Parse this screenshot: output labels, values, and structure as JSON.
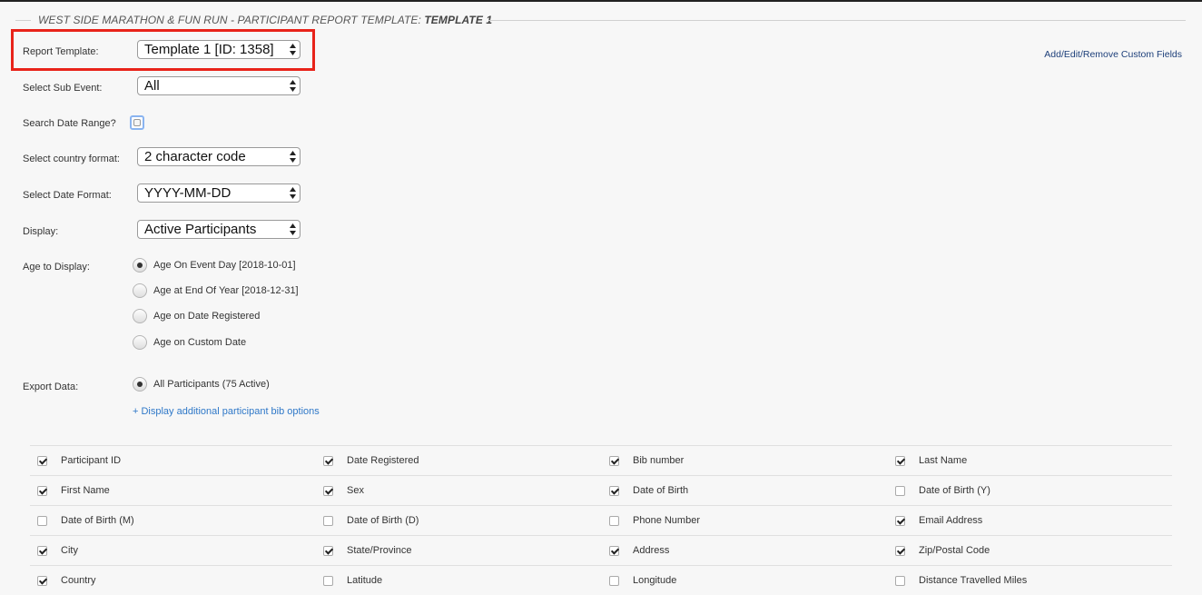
{
  "header": {
    "title_prefix": "WEST SIDE MARATHON & FUN RUN - PARTICIPANT REPORT TEMPLATE: ",
    "title_template": "TEMPLATE 1"
  },
  "links": {
    "custom_fields": "Add/Edit/Remove Custom Fields",
    "bib_options": "+ Display additional participant bib options"
  },
  "form": {
    "report_template": {
      "label": "Report Template:",
      "value": "Template 1 [ID: 1358]"
    },
    "sub_event": {
      "label": "Select Sub Event:",
      "value": "All"
    },
    "date_range": {
      "label": "Search Date Range?",
      "checked": false
    },
    "country_format": {
      "label": "Select country format:",
      "value": "2 character code"
    },
    "date_format": {
      "label": "Select Date Format:",
      "value": "YYYY-MM-DD"
    },
    "display": {
      "label": "Display:",
      "value": "Active Participants"
    },
    "age_display": {
      "label": "Age to Display:",
      "options": [
        {
          "label": "Age On Event Day [2018-10-01]",
          "checked": true
        },
        {
          "label": "Age at End Of Year [2018-12-31]",
          "checked": false
        },
        {
          "label": "Age on Date Registered",
          "checked": false
        },
        {
          "label": "Age on Custom Date",
          "checked": false
        }
      ]
    },
    "export_data": {
      "label": "Export Data:",
      "options": [
        {
          "label": "All Participants (75 Active)",
          "checked": true
        }
      ]
    }
  },
  "fields": [
    [
      {
        "label": "Participant ID",
        "checked": true
      },
      {
        "label": "Date Registered",
        "checked": true
      },
      {
        "label": "Bib number",
        "checked": true
      },
      {
        "label": "Last Name",
        "checked": true
      }
    ],
    [
      {
        "label": "First Name",
        "checked": true
      },
      {
        "label": "Sex",
        "checked": true
      },
      {
        "label": "Date of Birth",
        "checked": true
      },
      {
        "label": "Date of Birth (Y)",
        "checked": false
      }
    ],
    [
      {
        "label": "Date of Birth (M)",
        "checked": false
      },
      {
        "label": "Date of Birth (D)",
        "checked": false
      },
      {
        "label": "Phone Number",
        "checked": false
      },
      {
        "label": "Email Address",
        "checked": true
      }
    ],
    [
      {
        "label": "City",
        "checked": true
      },
      {
        "label": "State/Province",
        "checked": true
      },
      {
        "label": "Address",
        "checked": true
      },
      {
        "label": "Zip/Postal Code",
        "checked": true
      }
    ],
    [
      {
        "label": "Country",
        "checked": true
      },
      {
        "label": "Latitude",
        "checked": false
      },
      {
        "label": "Longitude",
        "checked": false
      },
      {
        "label": "Distance Travelled Miles",
        "checked": false
      }
    ]
  ],
  "colors": {
    "highlight": "#e8231a",
    "link": "#2f78c8",
    "link_dark": "#1d3f7a",
    "focus": "#8ab4f0"
  }
}
